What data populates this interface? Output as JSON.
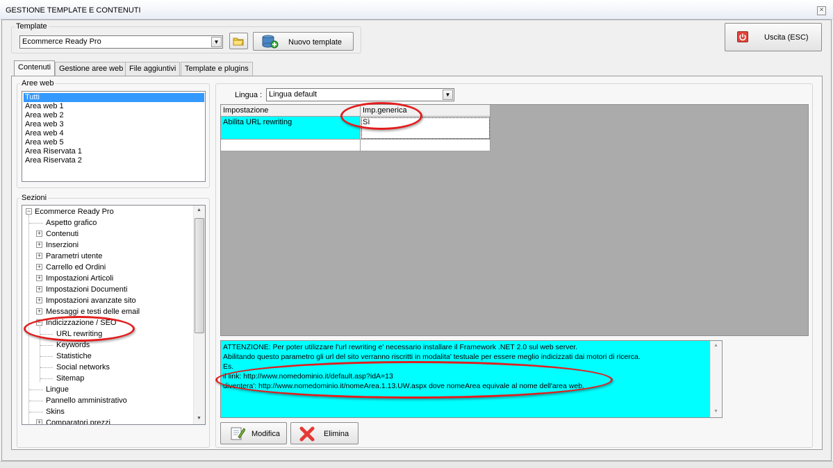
{
  "window": {
    "title": "GESTIONE TEMPLATE E CONTENUTI",
    "close_glyph": "×"
  },
  "template_group": {
    "legend": "Template",
    "selected_template": "Ecommerce Ready Pro",
    "new_template_label": "Nuovo template"
  },
  "exit_button": {
    "label": "Uscita (ESC)"
  },
  "tabs": [
    {
      "label": "Contenuti"
    },
    {
      "label": "Gestione aree web"
    },
    {
      "label": "File aggiuntivi"
    },
    {
      "label": "Template e plugins"
    }
  ],
  "aree_web": {
    "legend": "Aree web",
    "items": [
      "Tutti",
      "Area web 1",
      "Area web 2",
      "Area web 3",
      "Area web 4",
      "Area web 5",
      "Area Riservata 1",
      "Area Riservata 2"
    ]
  },
  "sezioni": {
    "legend": "Sezioni",
    "root": "Ecommerce Ready Pro",
    "nodes": [
      {
        "label": "Aspetto grafico"
      },
      {
        "label": "Contenuti"
      },
      {
        "label": "Inserzioni"
      },
      {
        "label": "Parametri utente"
      },
      {
        "label": "Carrello ed Ordini"
      },
      {
        "label": "Impostazioni Articoli"
      },
      {
        "label": "Impostazioni Documenti"
      },
      {
        "label": "Impostazioni avanzate sito"
      },
      {
        "label": "Messaggi e testi delle email"
      },
      {
        "label": "Indicizzazione / SEO"
      },
      {
        "label": "URL rewriting"
      },
      {
        "label": "Keywords"
      },
      {
        "label": "Statistiche"
      },
      {
        "label": "Social networks"
      },
      {
        "label": "Sitemap"
      },
      {
        "label": "Lingue"
      },
      {
        "label": "Pannello amministrativo"
      },
      {
        "label": "Skins"
      },
      {
        "label": "Comparatori prezzi"
      }
    ]
  },
  "lingua": {
    "label": "Lingua :",
    "value": "Lingua default"
  },
  "grid": {
    "headers": [
      "Impostazione",
      "Imp.generica"
    ],
    "rows": [
      {
        "impostazione": "Abilita URL rewriting",
        "valore": "Sì"
      }
    ]
  },
  "description": {
    "lines": [
      "ATTENZIONE: Per poter utilizzare l'url rewriting e' necessario installare il Framework .NET 2.0 sul web server.",
      "Abilitando questo parametro gli url del sito verranno riscritti in modalita' testuale per essere meglio indicizzati dai motori di ricerca.",
      "Es.",
      "il link: http://www.nomedominio.it/default.asp?idA=13",
      "diventera': http://www.nomedominio.it/nomeArea.1.13.UW.aspx dove nomeArea equivale al nome dell'area web."
    ]
  },
  "actions": {
    "modifica_label": "Modifica",
    "elimina_label": "Elimina"
  },
  "colors": {
    "selection": "#3399ff",
    "highlight_cyan": "#00ffff",
    "annotation_red": "#e21d1d",
    "grid_bg": "#ababab"
  }
}
